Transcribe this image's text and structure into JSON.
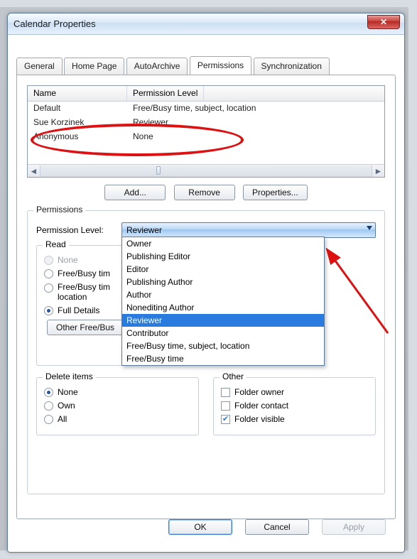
{
  "window": {
    "title": "Calendar Properties"
  },
  "tabs": [
    "General",
    "Home Page",
    "AutoArchive",
    "Permissions",
    "Synchronization"
  ],
  "active_tab_index": 3,
  "listview": {
    "columns": [
      "Name",
      "Permission Level"
    ],
    "rows": [
      {
        "name": "Default",
        "level": "Free/Busy time, subject, location"
      },
      {
        "name": "Sue Korzinek",
        "level": "Reviewer"
      },
      {
        "name": "Anonymous",
        "level": "None"
      }
    ]
  },
  "buttons": {
    "add": "Add...",
    "remove": "Remove",
    "properties": "Properties..."
  },
  "permissions": {
    "section_label": "Permissions",
    "level_label": "Permission Level:",
    "selected_level": "Reviewer",
    "options": [
      "Owner",
      "Publishing Editor",
      "Editor",
      "Publishing Author",
      "Author",
      "Nonediting Author",
      "Reviewer",
      "Contributor",
      "Free/Busy time, subject, location",
      "Free/Busy time"
    ],
    "read": {
      "legend": "Read",
      "options": [
        "None",
        "Free/Busy tim",
        "Free/Busy tim\nlocation",
        "Full Details"
      ],
      "selected_index": 3,
      "disabled_index": 0,
      "other_button": "Other Free/Bus"
    },
    "delete": {
      "legend": "Delete items",
      "options": [
        "None",
        "Own",
        "All"
      ],
      "selected_index": 0
    },
    "other": {
      "legend": "Other",
      "items": [
        {
          "label": "Folder owner",
          "checked": false
        },
        {
          "label": "Folder contact",
          "checked": false
        },
        {
          "label": "Folder visible",
          "checked": true
        }
      ]
    }
  },
  "footer": {
    "ok": "OK",
    "cancel": "Cancel",
    "apply": "Apply"
  }
}
